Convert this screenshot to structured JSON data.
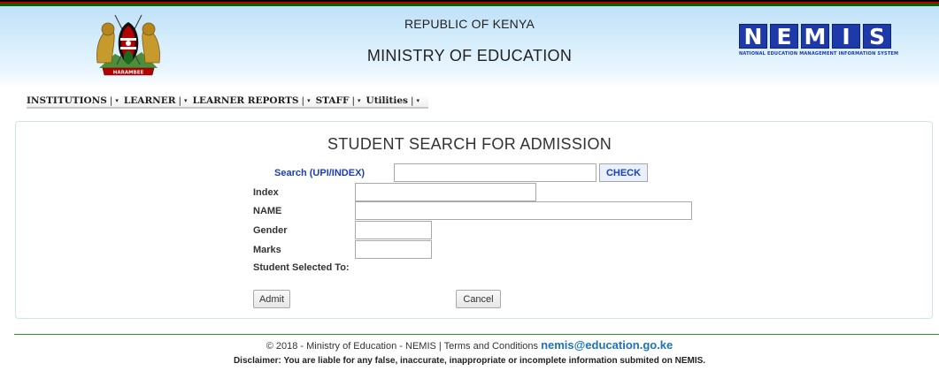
{
  "header": {
    "republic": "REPUBLIC OF KENYA",
    "ministry": "MINISTRY OF EDUCATION",
    "logo": {
      "letters": [
        "N",
        "E",
        "M",
        "I",
        "S"
      ],
      "subtitle": "NATIONAL EDUCATION MANAGEMENT INFORMATION SYSTEM"
    },
    "coat_of_arms": "HARAMBEE"
  },
  "menu": {
    "items": [
      {
        "label": "INSTITUTIONS"
      },
      {
        "label": "LEARNER"
      },
      {
        "label": "LEARNER REPORTS"
      },
      {
        "label": "STAFF"
      },
      {
        "label": "Utilities"
      }
    ],
    "separator": "|",
    "caret": "▾"
  },
  "form": {
    "title": "STUDENT SEARCH FOR ADMISSION",
    "search_label": "Search (UPI/INDEX)",
    "search_value": "",
    "check_label": "CHECK",
    "fields": {
      "index_label": "Index",
      "name_label": "NAME",
      "gender_label": "Gender",
      "marks_label": "Marks",
      "selected_to_label": "Student Selected To:"
    },
    "admit_label": "Admit",
    "cancel_label": "Cancel"
  },
  "footer": {
    "copyright": "© 2018 - Ministry of Education - NEMIS | Terms and Conditions",
    "email": "nemis@education.go.ke",
    "disclaimer": "Disclaimer: You are liable for any false, inaccurate, inappropriate or incomplete information submited on NEMIS."
  },
  "colors": {
    "accent_blue": "#1a3fb8",
    "logo_blue": "#1d3aa8",
    "footer_green": "#2e8b2e",
    "link_blue": "#1f73b7"
  }
}
